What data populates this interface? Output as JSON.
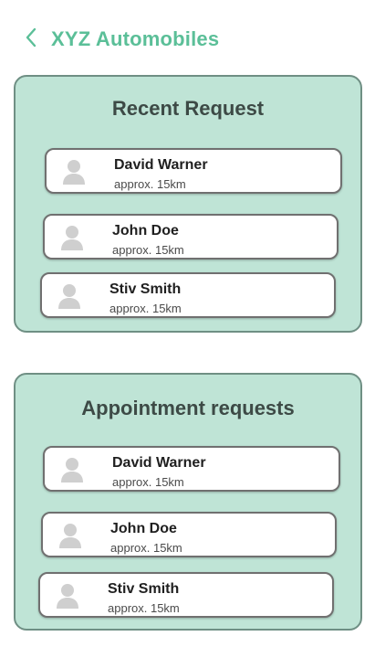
{
  "header": {
    "title": "XYZ Automobiles",
    "back_icon": "chevron-left-icon"
  },
  "colors": {
    "accent": "#5bbf98",
    "panel_bg": "#bfe4d6",
    "panel_border": "#6f8f84"
  },
  "recent": {
    "title": "Recent Request",
    "items": [
      {
        "name": "David Warner",
        "distance": "approx.  15km"
      },
      {
        "name": "John Doe",
        "distance": "approx.  15km"
      },
      {
        "name": "Stiv Smith",
        "distance": "approx.  15km"
      }
    ]
  },
  "appointments": {
    "title": "Appointment requests",
    "items": [
      {
        "name": "David Warner",
        "distance": "approx.  15km"
      },
      {
        "name": "John Doe",
        "distance": "approx.  15km"
      },
      {
        "name": "Stiv Smith",
        "distance": "approx.  15km"
      }
    ]
  }
}
